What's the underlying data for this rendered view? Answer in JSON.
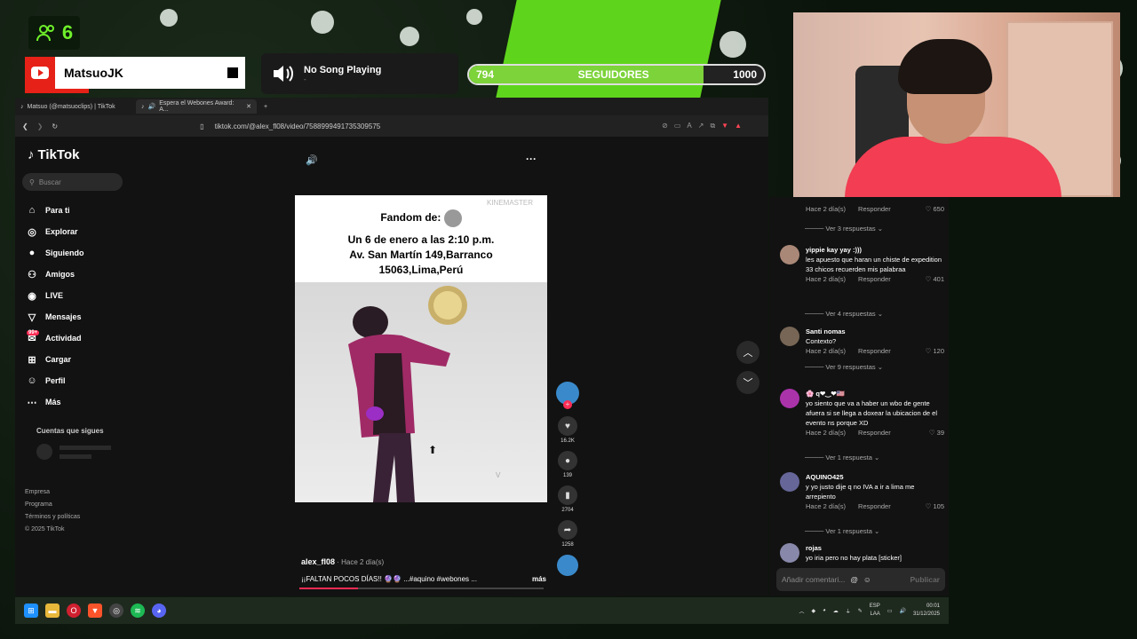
{
  "overlay": {
    "viewers": "6",
    "channel_name": "MatsuoJK",
    "song_title": "No Song Playing",
    "song_sub": "-",
    "followers_current": "794",
    "followers_label": "SEGUIDORES",
    "followers_goal": "1000",
    "followers_progress": 0.794,
    "accent_color": "#6ff02a"
  },
  "browser": {
    "tabs": [
      {
        "label": "Matsuo (@matsuoclips) | TikTok"
      },
      {
        "label": "Espera el Webones Award: A..."
      }
    ],
    "url": "tiktok.com/@alex_fl08/video/7588999491735309575"
  },
  "tiktok": {
    "logo": "TikTok",
    "search_placeholder": "Buscar",
    "nav": [
      {
        "label": "Para ti",
        "icon": "home-icon",
        "glyph": "⌂"
      },
      {
        "label": "Explorar",
        "icon": "compass-icon",
        "glyph": "◎"
      },
      {
        "label": "Siguiendo",
        "icon": "following-icon",
        "glyph": "●"
      },
      {
        "label": "Amigos",
        "icon": "friends-icon",
        "glyph": "⚇"
      },
      {
        "label": "LIVE",
        "icon": "live-icon",
        "glyph": "◉"
      },
      {
        "label": "Mensajes",
        "icon": "messages-icon",
        "glyph": "▽"
      },
      {
        "label": "Actividad",
        "icon": "activity-icon",
        "glyph": "✉"
      },
      {
        "label": "Cargar",
        "icon": "upload-icon",
        "glyph": "⊞"
      },
      {
        "label": "Perfil",
        "icon": "profile-icon",
        "glyph": "☺"
      },
      {
        "label": "Más",
        "icon": "more-icon",
        "glyph": "⋯"
      }
    ],
    "activity_badge": "99+",
    "follows_title": "Cuentas que sigues",
    "footer": [
      "Empresa",
      "Programa",
      "Términos y políticas",
      "© 2025 TikTok"
    ]
  },
  "video": {
    "watermark": "KINEMASTER",
    "header_title": "Fandom de:",
    "header_line1": "Un 6 de enero a las 2:10 p.m.",
    "header_line2": "Av. San Martín 149,Barranco",
    "header_line3": "15063,Lima,Perú",
    "username": "alex_fl08",
    "time": "· Hace 2 día(s)",
    "description": "¡¡FALTAN POCOS DÍAS!! 🔮🔮 ...#aquino #webones ...",
    "more": "más",
    "progress": 0.24,
    "likes": "16.2K",
    "comments": "139",
    "saves": "2704",
    "shares": "1258"
  },
  "comments": {
    "items": [
      {
        "user": "",
        "text": "",
        "time": "Hace 2 día(s)",
        "reply": "Responder",
        "likes": "650",
        "replies": "Ver 3 respuestas"
      },
      {
        "user": "yippie kay yay :)))",
        "text": "les apuesto que haran un chiste de expedition 33 chicos recuerden mis palabraa",
        "time": "Hace 2 día(s)",
        "reply": "Responder",
        "likes": "401",
        "replies": "Ver 4 respuestas"
      },
      {
        "user": "Santi nomas",
        "text": "Contexto?",
        "time": "Hace 2 día(s)",
        "reply": "Responder",
        "likes": "120",
        "replies": "Ver 9 respuestas"
      },
      {
        "user": "🌸 q❤‿❤🇺🇸",
        "text": "yo siento que va a haber un wbo de gente afuera si se llega a doxear la ubicacion de el evento ns porque XD",
        "time": "Hace 2 día(s)",
        "reply": "Responder",
        "likes": "39",
        "replies": "Ver 1 respuesta"
      },
      {
        "user": "AQUINO425",
        "text": "y yo justo dije q no IVA a ir a lima me arrepiento",
        "time": "Hace 2 día(s)",
        "reply": "Responder",
        "likes": "105",
        "replies": "Ver 1 respuesta"
      },
      {
        "user": "rojas",
        "text": "yo iria pero no hay plata [sticker]"
      }
    ],
    "input_placeholder": "Añadir comentari...",
    "post_label": "Publicar"
  },
  "taskbar": {
    "lang_line1": "ESP",
    "lang_line2": "LAA",
    "time": "00:01",
    "date": "31/12/2025"
  }
}
